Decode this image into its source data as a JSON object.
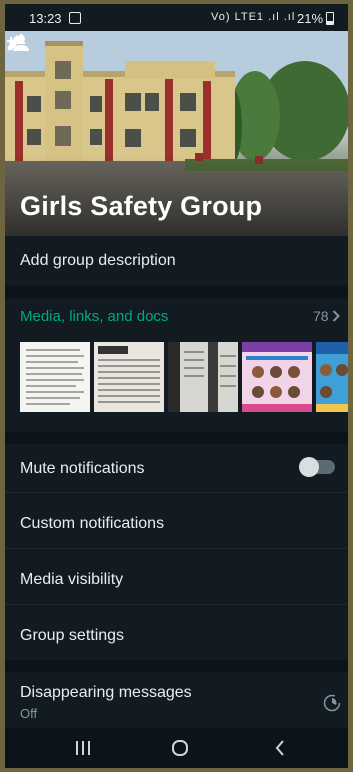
{
  "status_bar": {
    "time": "13:23",
    "network_icons": "Vo) LTE1 .ıl .ıl",
    "battery": "21%"
  },
  "header": {
    "group_name": "Girls Safety Group",
    "back_icon": "arrow-left-icon",
    "add_participant_icon": "person-add-icon",
    "edit_icon": "pencil-icon"
  },
  "description": {
    "label": "Add group description"
  },
  "media": {
    "title": "Media, links, and docs",
    "count": "78",
    "accent_color": "#00a884"
  },
  "settings": {
    "mute": "Mute notifications",
    "mute_enabled": false,
    "custom": "Custom notifications",
    "visibility": "Media visibility",
    "group_settings": "Group settings"
  },
  "disappearing": {
    "label": "Disappearing messages",
    "value": "Off"
  }
}
